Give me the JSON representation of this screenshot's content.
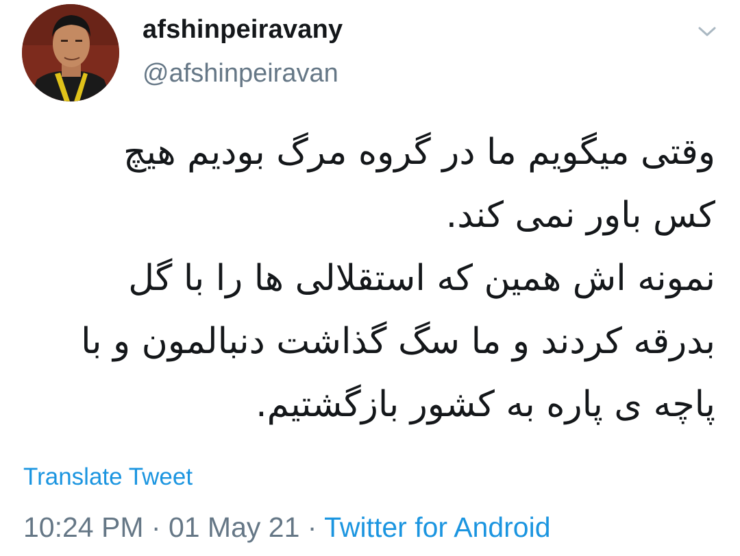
{
  "profile": {
    "display_name": "afshinpeiravany",
    "handle": "@afshinpeiravan",
    "avatar_icon": "profile-photo",
    "menu_icon": "chevron-down-icon"
  },
  "tweet": {
    "lines": [
      "وقتی میگویم ما در گروه مرگ بودیم هیچ",
      "کس باور نمی کند.",
      "نمونه اش همین که استقلالی ها را با گل",
      "بدرقه کردند و ما سگ گذاشت دنبالمون و با",
      "پاچه ی پاره به کشور بازگشتیم."
    ]
  },
  "translate_label": "Translate Tweet",
  "meta": {
    "time": "10:24 PM",
    "separator": " · ",
    "date": "01 May 21",
    "source": "Twitter for Android"
  },
  "colors": {
    "link": "#1b95e0",
    "secondary_text": "#657786",
    "primary_text": "#14171a"
  }
}
